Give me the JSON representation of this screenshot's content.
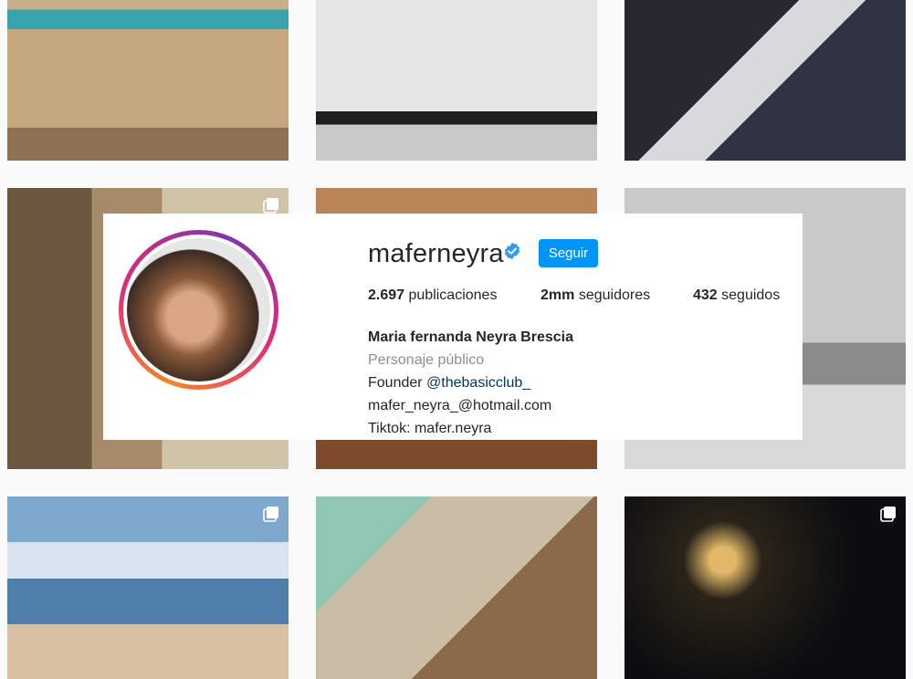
{
  "profile": {
    "username": "maferneyra",
    "verified_icon": "verified-badge-icon",
    "follow_label": "Seguir",
    "stats": {
      "posts_value": "2.697",
      "posts_label": "publicaciones",
      "followers_value": "2mm",
      "followers_label": "seguidores",
      "following_value": "432",
      "following_label": "seguidos"
    },
    "bio": {
      "full_name": "Maria fernanda Neyra Brescia",
      "category": "Personaje público",
      "line1_prefix": "Founder",
      "line1_mention": "@thebasicclub_",
      "email": "mafer_neyra_@hotmail.com",
      "tiktok": "Tiktok: mafer.neyra"
    }
  },
  "colors": {
    "accent": "#0095f6",
    "mention": "#00376b",
    "muted": "#8e8e8e",
    "text": "#262626",
    "background": "#fafafa"
  },
  "grid": {
    "multi_post_icon": "multiple-photos-icon"
  }
}
